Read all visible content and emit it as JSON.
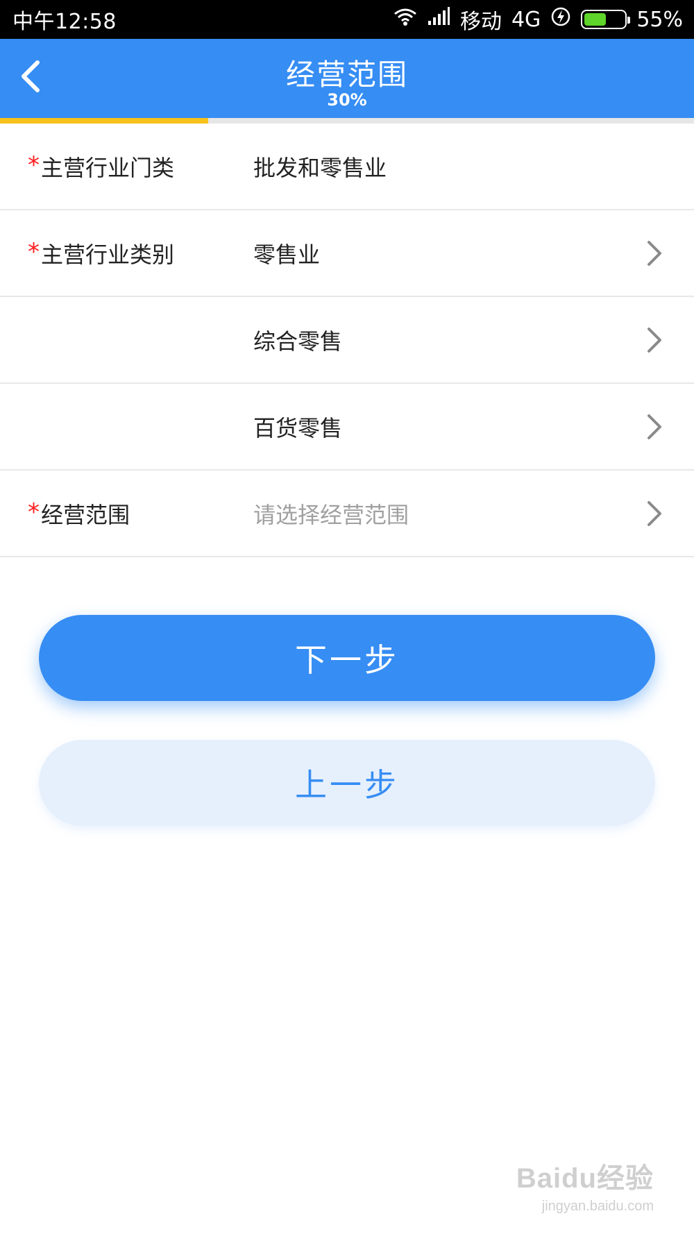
{
  "status_bar": {
    "time": "中午12:58",
    "carrier": "移动",
    "network": "4G",
    "battery_text": "55%",
    "battery_level": 0.55,
    "icons": [
      "wifi-icon",
      "signal-icon",
      "charging-icon",
      "battery-icon"
    ]
  },
  "header": {
    "title": "经营范围",
    "progress_text": "30%",
    "back_icon": "chevron-left-icon",
    "progress": 0.3
  },
  "colors": {
    "primary": "#368df3",
    "progress": "#f6c21c",
    "required": "#ff1c1c",
    "secondary_button_bg": "#e6f0fd"
  },
  "form": {
    "rows": [
      {
        "required": true,
        "label": "主营行业门类",
        "value": "批发和零售业",
        "has_chevron": false
      },
      {
        "required": true,
        "label": "主营行业类别",
        "value": "零售业",
        "has_chevron": true
      },
      {
        "required": false,
        "label": "",
        "value": "综合零售",
        "has_chevron": true
      },
      {
        "required": false,
        "label": "",
        "value": "百货零售",
        "has_chevron": true
      },
      {
        "required": true,
        "label": "经营范围",
        "placeholder": "请选择经营范围",
        "has_chevron": true
      }
    ],
    "required_mark": "*"
  },
  "buttons": {
    "next_label": "下一步",
    "prev_label": "上一步"
  },
  "watermark": {
    "logo": "Baidu经验",
    "url": "jingyan.baidu.com"
  }
}
